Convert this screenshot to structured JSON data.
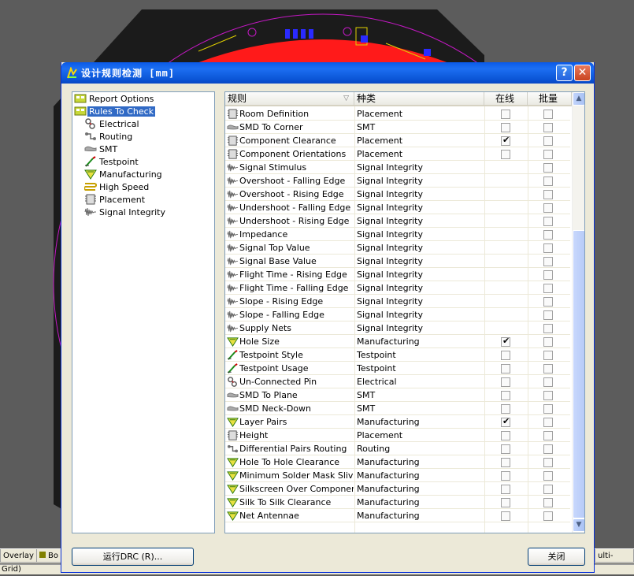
{
  "background": {
    "bottom_tabs": [
      "Overlay",
      "Bo",
      "ulti-Layer"
    ],
    "status": "Grid)"
  },
  "dialog": {
    "title": "设计规则检测 [mm]",
    "help_glyph": "?",
    "close_glyph": "✕",
    "run_button": "运行DRC (R)...",
    "close_button": "关闭"
  },
  "tree": [
    {
      "label": "Report Options",
      "icon": "report-options-icon",
      "level": 0,
      "selected": false
    },
    {
      "label": "Rules To Check",
      "icon": "rules-to-check-icon",
      "level": 0,
      "selected": true
    },
    {
      "label": "Electrical",
      "icon": "electrical-icon",
      "level": 1,
      "selected": false
    },
    {
      "label": "Routing",
      "icon": "routing-icon",
      "level": 1,
      "selected": false
    },
    {
      "label": "SMT",
      "icon": "smt-icon",
      "level": 1,
      "selected": false
    },
    {
      "label": "Testpoint",
      "icon": "testpoint-icon",
      "level": 1,
      "selected": false
    },
    {
      "label": "Manufacturing",
      "icon": "manufacturing-icon",
      "level": 1,
      "selected": false
    },
    {
      "label": "High Speed",
      "icon": "high-speed-icon",
      "level": 1,
      "selected": false
    },
    {
      "label": "Placement",
      "icon": "placement-icon",
      "level": 1,
      "selected": false
    },
    {
      "label": "Signal Integrity",
      "icon": "signal-integrity-icon",
      "level": 1,
      "selected": false
    }
  ],
  "grid": {
    "columns": [
      "规则",
      "种类",
      "在线",
      "批量"
    ],
    "sort_indicator": "▽",
    "rows": [
      {
        "rule": "Room Definition",
        "category": "Placement",
        "online": false,
        "batch": false,
        "online_enabled": true,
        "icon": "placement-icon"
      },
      {
        "rule": "SMD To Corner",
        "category": "SMT",
        "online": false,
        "batch": false,
        "online_enabled": true,
        "icon": "smt-icon"
      },
      {
        "rule": "Component Clearance",
        "category": "Placement",
        "online": true,
        "batch": false,
        "online_enabled": true,
        "icon": "placement-icon"
      },
      {
        "rule": "Component Orientations",
        "category": "Placement",
        "online": false,
        "batch": false,
        "online_enabled": true,
        "icon": "placement-icon"
      },
      {
        "rule": "Signal Stimulus",
        "category": "Signal Integrity",
        "online": false,
        "batch": false,
        "online_enabled": false,
        "icon": "signal-integrity-icon"
      },
      {
        "rule": "Overshoot - Falling Edge",
        "category": "Signal Integrity",
        "online": false,
        "batch": false,
        "online_enabled": false,
        "icon": "signal-integrity-icon"
      },
      {
        "rule": "Overshoot - Rising Edge",
        "category": "Signal Integrity",
        "online": false,
        "batch": false,
        "online_enabled": false,
        "icon": "signal-integrity-icon"
      },
      {
        "rule": "Undershoot - Falling Edge",
        "category": "Signal Integrity",
        "online": false,
        "batch": false,
        "online_enabled": false,
        "icon": "signal-integrity-icon"
      },
      {
        "rule": "Undershoot - Rising Edge",
        "category": "Signal Integrity",
        "online": false,
        "batch": false,
        "online_enabled": false,
        "icon": "signal-integrity-icon"
      },
      {
        "rule": "Impedance",
        "category": "Signal Integrity",
        "online": false,
        "batch": false,
        "online_enabled": false,
        "icon": "signal-integrity-icon"
      },
      {
        "rule": "Signal Top Value",
        "category": "Signal Integrity",
        "online": false,
        "batch": false,
        "online_enabled": false,
        "icon": "signal-integrity-icon"
      },
      {
        "rule": "Signal Base Value",
        "category": "Signal Integrity",
        "online": false,
        "batch": false,
        "online_enabled": false,
        "icon": "signal-integrity-icon"
      },
      {
        "rule": "Flight Time - Rising Edge",
        "category": "Signal Integrity",
        "online": false,
        "batch": false,
        "online_enabled": false,
        "icon": "signal-integrity-icon"
      },
      {
        "rule": "Flight Time - Falling Edge",
        "category": "Signal Integrity",
        "online": false,
        "batch": false,
        "online_enabled": false,
        "icon": "signal-integrity-icon"
      },
      {
        "rule": "Slope - Rising Edge",
        "category": "Signal Integrity",
        "online": false,
        "batch": false,
        "online_enabled": false,
        "icon": "signal-integrity-icon"
      },
      {
        "rule": "Slope - Falling Edge",
        "category": "Signal Integrity",
        "online": false,
        "batch": false,
        "online_enabled": false,
        "icon": "signal-integrity-icon"
      },
      {
        "rule": "Supply Nets",
        "category": "Signal Integrity",
        "online": false,
        "batch": false,
        "online_enabled": false,
        "icon": "signal-integrity-icon"
      },
      {
        "rule": "Hole Size",
        "category": "Manufacturing",
        "online": true,
        "batch": false,
        "online_enabled": true,
        "icon": "manufacturing-icon"
      },
      {
        "rule": "Testpoint Style",
        "category": "Testpoint",
        "online": false,
        "batch": false,
        "online_enabled": true,
        "icon": "testpoint-icon"
      },
      {
        "rule": "Testpoint Usage",
        "category": "Testpoint",
        "online": false,
        "batch": false,
        "online_enabled": true,
        "icon": "testpoint-icon"
      },
      {
        "rule": "Un-Connected Pin",
        "category": "Electrical",
        "online": false,
        "batch": false,
        "online_enabled": true,
        "icon": "electrical-icon"
      },
      {
        "rule": "SMD To Plane",
        "category": "SMT",
        "online": false,
        "batch": false,
        "online_enabled": true,
        "icon": "smt-icon"
      },
      {
        "rule": "SMD Neck-Down",
        "category": "SMT",
        "online": false,
        "batch": false,
        "online_enabled": true,
        "icon": "smt-icon"
      },
      {
        "rule": "Layer Pairs",
        "category": "Manufacturing",
        "online": true,
        "batch": false,
        "online_enabled": true,
        "icon": "manufacturing-icon"
      },
      {
        "rule": "Height",
        "category": "Placement",
        "online": false,
        "batch": false,
        "online_enabled": true,
        "icon": "placement-icon"
      },
      {
        "rule": "Differential Pairs Routing",
        "category": "Routing",
        "online": false,
        "batch": false,
        "online_enabled": true,
        "icon": "routing-icon"
      },
      {
        "rule": "Hole To Hole Clearance",
        "category": "Manufacturing",
        "online": false,
        "batch": false,
        "online_enabled": true,
        "icon": "manufacturing-icon"
      },
      {
        "rule": "Minimum Solder Mask Sliver",
        "category": "Manufacturing",
        "online": false,
        "batch": false,
        "online_enabled": true,
        "icon": "manufacturing-icon"
      },
      {
        "rule": "Silkscreen Over Component Pads",
        "category": "Manufacturing",
        "online": false,
        "batch": false,
        "online_enabled": true,
        "icon": "manufacturing-icon"
      },
      {
        "rule": "Silk To Silk Clearance",
        "category": "Manufacturing",
        "online": false,
        "batch": false,
        "online_enabled": true,
        "icon": "manufacturing-icon"
      },
      {
        "rule": "Net Antennae",
        "category": "Manufacturing",
        "online": false,
        "batch": false,
        "online_enabled": true,
        "icon": "manufacturing-icon"
      }
    ]
  },
  "colors": {
    "titlebar": "#0a5ae8",
    "selection": "#316ac5",
    "dialog_bg": "#ece9d8",
    "pcb_board": "#1a1a1a",
    "pcb_red": "#ff1a1a",
    "pcb_outline": "#d020d0"
  }
}
